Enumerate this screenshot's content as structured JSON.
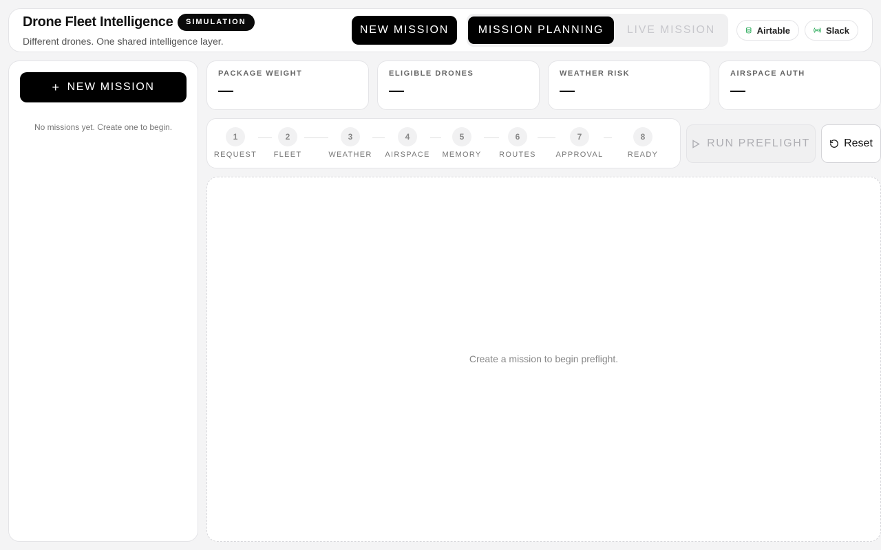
{
  "header": {
    "title": "Drone Fleet Intelligence",
    "badge": "SIMULATION",
    "subtitle": "Different drones. One shared intelligence layer.",
    "new_mission_label": "NEW MISSION",
    "mode_tabs": [
      {
        "label": "MISSION PLANNING",
        "active": true
      },
      {
        "label": "LIVE MISSION",
        "active": false
      }
    ],
    "integrations": [
      {
        "label": "Airtable",
        "icon": "database-icon"
      },
      {
        "label": "Slack",
        "icon": "broadcast-icon"
      }
    ]
  },
  "sidebar": {
    "new_mission_label": "NEW MISSION",
    "empty_text": "No missions yet. Create one to begin."
  },
  "stats": [
    {
      "label": "PACKAGE WEIGHT",
      "value": "—"
    },
    {
      "label": "ELIGIBLE DRONES",
      "value": "—"
    },
    {
      "label": "WEATHER RISK",
      "value": "—"
    },
    {
      "label": "AIRSPACE AUTH",
      "value": "—"
    }
  ],
  "steps": [
    {
      "num": "1",
      "label": "REQUEST"
    },
    {
      "num": "2",
      "label": "FLEET"
    },
    {
      "num": "3",
      "label": "WEATHER"
    },
    {
      "num": "4",
      "label": "AIRSPACE"
    },
    {
      "num": "5",
      "label": "MEMORY"
    },
    {
      "num": "6",
      "label": "ROUTES"
    },
    {
      "num": "7",
      "label": "APPROVAL"
    },
    {
      "num": "8",
      "label": "READY"
    }
  ],
  "actions": {
    "run_label": "RUN PREFLIGHT",
    "reset_label": "Reset"
  },
  "canvas": {
    "empty_text": "Create a mission to begin preflight."
  },
  "colors": {
    "accent": "#000000",
    "integration_icon": "#16a34a"
  }
}
